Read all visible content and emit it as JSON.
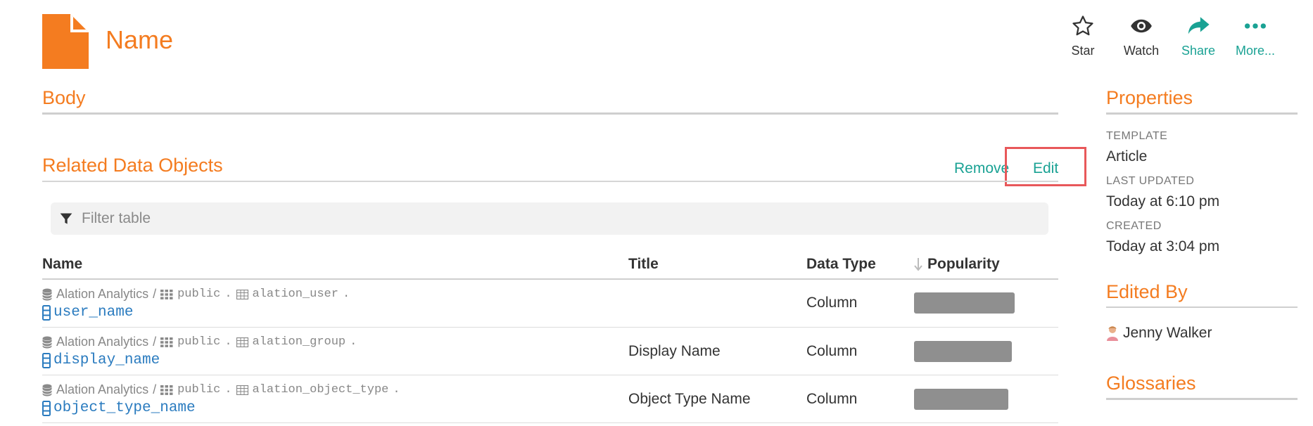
{
  "header": {
    "title": "Name",
    "actions": [
      {
        "label": "Star",
        "icon": "star-icon"
      },
      {
        "label": "Watch",
        "icon": "eye-icon"
      },
      {
        "label": "Share",
        "icon": "share-icon"
      },
      {
        "label": "More...",
        "icon": "more-icon"
      }
    ]
  },
  "body_section": {
    "heading": "Body"
  },
  "related": {
    "heading": "Related Data Objects",
    "remove_label": "Remove",
    "edit_label": "Edit",
    "filter_placeholder": "Filter table",
    "columns": [
      "Name",
      "Title",
      "Data Type",
      "Popularity"
    ],
    "rows": [
      {
        "datasource": "Alation Analytics",
        "schema": "public",
        "table": "alation_user",
        "column": "user_name",
        "title": "",
        "data_type": "Column",
        "popularity": 1.0
      },
      {
        "datasource": "Alation Analytics",
        "schema": "public",
        "table": "alation_group",
        "column": "display_name",
        "title": "Display Name",
        "data_type": "Column",
        "popularity": 0.97
      },
      {
        "datasource": "Alation Analytics",
        "schema": "public",
        "table": "alation_object_type",
        "column": "object_type_name",
        "title": "Object Type Name",
        "data_type": "Column",
        "popularity": 0.94
      }
    ]
  },
  "sidebar": {
    "properties_heading": "Properties",
    "template_label": "TEMPLATE",
    "template_value": "Article",
    "last_updated_label": "LAST UPDATED",
    "last_updated_value": "Today at 6:10 pm",
    "created_label": "CREATED",
    "created_value": "Today at 3:04 pm",
    "edited_by_heading": "Edited By",
    "editor_name": "Jenny Walker",
    "glossaries_heading": "Glossaries"
  },
  "colors": {
    "accent": "#f47c20",
    "link": "#1aa294",
    "object_link": "#2a7bbf",
    "highlight": "#e8585a"
  },
  "separator": "/",
  "dot": "."
}
